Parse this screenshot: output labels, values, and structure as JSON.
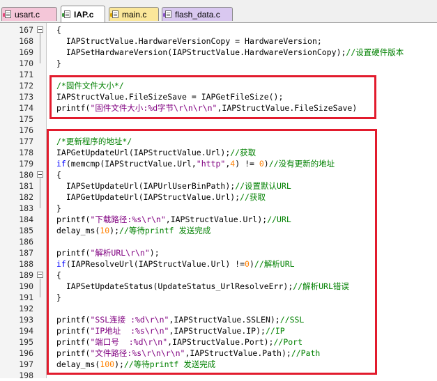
{
  "tabs": [
    {
      "label": "usart.c",
      "color": "#f4c6d8",
      "mark": "#e04a7a"
    },
    {
      "label": "IAP.c",
      "color": "#ffffff",
      "mark": "#3a9a3a",
      "active": true
    },
    {
      "label": "main.c",
      "color": "#fbe79a",
      "mark": "#d9a400"
    },
    {
      "label": "flash_data.c",
      "color": "#d9c8f0",
      "mark": "#8a56c8"
    }
  ],
  "lines": [
    {
      "n": "167",
      "fold": true,
      "tokens": [
        {
          "t": "{"
        }
      ]
    },
    {
      "n": "168",
      "tokens": [
        {
          "t": "  IAPStructValue.HardwareVersionCopy = HardwareVersion;"
        }
      ]
    },
    {
      "n": "169",
      "tokens": [
        {
          "t": "  IAPSetHardwareVersion(IAPStructValue.HardwareVersionCopy);"
        },
        {
          "t": "//设置硬件版本",
          "c": "cm"
        }
      ]
    },
    {
      "n": "170",
      "tokens": [
        {
          "t": "}"
        }
      ]
    },
    {
      "n": "171",
      "tokens": []
    },
    {
      "n": "172",
      "tokens": [
        {
          "t": "/*固件文件大小*/",
          "c": "cm"
        }
      ]
    },
    {
      "n": "173",
      "tokens": [
        {
          "t": "IAPStructValue.FileSizeSave = IAPGetFileSize();"
        }
      ]
    },
    {
      "n": "174",
      "tokens": [
        {
          "t": "printf("
        },
        {
          "t": "\"固件文件大小:%d字节\\r\\n\\r\\n\"",
          "c": "st"
        },
        {
          "t": ",IAPStructValue.FileSizeSave)"
        }
      ]
    },
    {
      "n": "175",
      "tokens": []
    },
    {
      "n": "176",
      "tokens": []
    },
    {
      "n": "177",
      "tokens": [
        {
          "t": "/*更新程序的地址*/",
          "c": "cm"
        }
      ]
    },
    {
      "n": "178",
      "tokens": [
        {
          "t": "IAPGetUpdateUrl(IAPStructValue.Url);"
        },
        {
          "t": "//获取",
          "c": "cm"
        }
      ]
    },
    {
      "n": "179",
      "tokens": [
        {
          "t": "if",
          "c": "kw"
        },
        {
          "t": "(memcmp(IAPStructValue.Url,"
        },
        {
          "t": "\"http\"",
          "c": "st"
        },
        {
          "t": ","
        },
        {
          "t": "4",
          "c": "nm"
        },
        {
          "t": ") != "
        },
        {
          "t": "0",
          "c": "nm"
        },
        {
          "t": ")"
        },
        {
          "t": "//没有更新的地址",
          "c": "cm"
        }
      ]
    },
    {
      "n": "180",
      "fold": true,
      "tokens": [
        {
          "t": "{"
        }
      ]
    },
    {
      "n": "181",
      "tokens": [
        {
          "t": "  IAPSetUpdateUrl(IAPUrlUserBinPath);"
        },
        {
          "t": "//设置默认URL",
          "c": "cm"
        }
      ]
    },
    {
      "n": "182",
      "tokens": [
        {
          "t": "  IAPGetUpdateUrl(IAPStructValue.Url);"
        },
        {
          "t": "//获取",
          "c": "cm"
        }
      ]
    },
    {
      "n": "183",
      "tokens": [
        {
          "t": "}"
        }
      ]
    },
    {
      "n": "184",
      "tokens": [
        {
          "t": "printf("
        },
        {
          "t": "\"下载路径:%s\\r\\n\"",
          "c": "st"
        },
        {
          "t": ",IAPStructValue.Url);"
        },
        {
          "t": "//URL",
          "c": "cm"
        }
      ]
    },
    {
      "n": "185",
      "tokens": [
        {
          "t": "delay_ms("
        },
        {
          "t": "10",
          "c": "nm"
        },
        {
          "t": ");"
        },
        {
          "t": "//等待printf 发送完成",
          "c": "cm"
        }
      ]
    },
    {
      "n": "186",
      "tokens": []
    },
    {
      "n": "187",
      "tokens": [
        {
          "t": "printf("
        },
        {
          "t": "\"解析URL\\r\\n\"",
          "c": "st"
        },
        {
          "t": ");"
        }
      ]
    },
    {
      "n": "188",
      "tokens": [
        {
          "t": "if",
          "c": "kw"
        },
        {
          "t": "(IAPResolveUrl(IAPStructValue.Url) !="
        },
        {
          "t": "0",
          "c": "nm"
        },
        {
          "t": ")"
        },
        {
          "t": "//解析URL",
          "c": "cm"
        }
      ]
    },
    {
      "n": "189",
      "fold": true,
      "tokens": [
        {
          "t": "{"
        }
      ]
    },
    {
      "n": "190",
      "tokens": [
        {
          "t": "  IAPSetUpdateStatus(UpdateStatus_UrlResolveErr);"
        },
        {
          "t": "//解析URL错误",
          "c": "cm"
        }
      ]
    },
    {
      "n": "191",
      "tokens": [
        {
          "t": "}"
        }
      ]
    },
    {
      "n": "192",
      "tokens": []
    },
    {
      "n": "193",
      "tokens": [
        {
          "t": "printf("
        },
        {
          "t": "\"SSL连接 :%d\\r\\n\"",
          "c": "st"
        },
        {
          "t": ",IAPStructValue.SSLEN);"
        },
        {
          "t": "//SSL",
          "c": "cm"
        }
      ]
    },
    {
      "n": "194",
      "tokens": [
        {
          "t": "printf("
        },
        {
          "t": "\"IP地址  :%s\\r\\n\"",
          "c": "st"
        },
        {
          "t": ",IAPStructValue.IP);"
        },
        {
          "t": "//IP",
          "c": "cm"
        }
      ]
    },
    {
      "n": "195",
      "tokens": [
        {
          "t": "printf("
        },
        {
          "t": "\"端口号  :%d\\r\\n\"",
          "c": "st"
        },
        {
          "t": ",IAPStructValue.Port);"
        },
        {
          "t": "//Port",
          "c": "cm"
        }
      ]
    },
    {
      "n": "196",
      "tokens": [
        {
          "t": "printf("
        },
        {
          "t": "\"文件路径:%s\\r\\n\\r\\n\"",
          "c": "st"
        },
        {
          "t": ",IAPStructValue.Path);"
        },
        {
          "t": "//Path",
          "c": "cm"
        }
      ]
    },
    {
      "n": "197",
      "tokens": [
        {
          "t": "delay_ms("
        },
        {
          "t": "100",
          "c": "nm"
        },
        {
          "t": ");"
        },
        {
          "t": "//等待printf 发送完成",
          "c": "cm"
        }
      ]
    },
    {
      "n": "198",
      "tokens": []
    }
  ],
  "colors": {
    "highlight_box": "#e21b2d",
    "comment": "#008000",
    "string": "#800080",
    "keyword": "#0000ff",
    "number": "#ff8000"
  }
}
